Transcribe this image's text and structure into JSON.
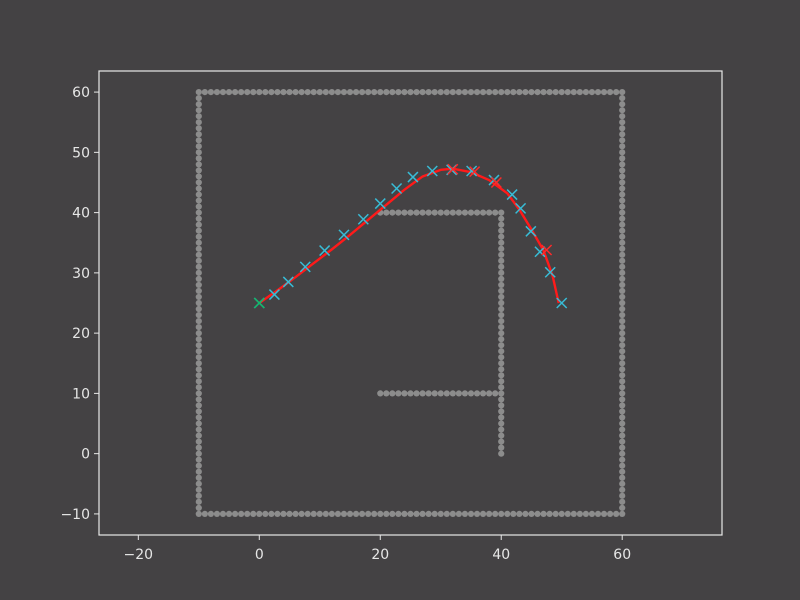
{
  "chart_data": {
    "type": "scatter",
    "title": "",
    "xlabel": "",
    "ylabel": "",
    "xlim": [
      -26.5,
      76.5
    ],
    "ylim": [
      -13.5,
      63.5
    ],
    "x_ticks": [
      -20,
      0,
      20,
      40,
      60
    ],
    "y_ticks": [
      -10,
      0,
      10,
      20,
      30,
      40,
      50,
      60
    ],
    "x_tick_labels": [
      "−20",
      "0",
      "20",
      "40",
      "60"
    ],
    "y_tick_labels": [
      "−10",
      "0",
      "10",
      "20",
      "30",
      "40",
      "50",
      "60"
    ],
    "grid": false,
    "legend": "none",
    "colors": {
      "background": "#444244",
      "axes_frame": "#e8e8e8",
      "obstacles": "#8c8c8c",
      "path": "#ff1a1a",
      "path_nodes": "#ff2a2a",
      "waypoints": "#38bcd6",
      "start": "#12b86a"
    },
    "obstacles": {
      "marker": "circle",
      "spacing": 1,
      "segments": [
        {
          "x": [
            -10,
            60
          ],
          "y": [
            60,
            60
          ]
        },
        {
          "x": [
            -10,
            60
          ],
          "y": [
            -10,
            -10
          ]
        },
        {
          "x": [
            -10,
            -10
          ],
          "y": [
            -10,
            60
          ]
        },
        {
          "x": [
            60,
            60
          ],
          "y": [
            -10,
            60
          ]
        },
        {
          "x": [
            20,
            40
          ],
          "y": [
            40,
            40
          ]
        },
        {
          "x": [
            40,
            40
          ],
          "y": [
            0,
            40
          ]
        },
        {
          "x": [
            20,
            40
          ],
          "y": [
            10,
            10
          ]
        }
      ]
    },
    "series": [
      {
        "marker": "x",
        "color": "#38bcd6",
        "x": [
          0,
          2.5,
          4.8,
          7.6,
          10.8,
          14,
          17.2,
          20,
          22.7,
          25.4,
          28.6,
          31.8,
          35.1,
          38.8,
          41.8,
          43.2,
          44.9,
          46.4,
          48.1,
          50
        ],
        "y": [
          25,
          26.4,
          28.5,
          31,
          33.7,
          36.3,
          38.9,
          41.5,
          44,
          45.9,
          46.9,
          47.1,
          46.9,
          45.4,
          43,
          40.7,
          36.9,
          33.5,
          30.1,
          25
        ]
      },
      {
        "marker": "x",
        "color": "#ff2a2a",
        "x": [
          32,
          35.6,
          39.2,
          47.5
        ],
        "y": [
          47.2,
          46.8,
          45,
          33.8
        ]
      },
      {
        "marker": "line",
        "color": "#ff1a1a",
        "x": [
          0,
          3,
          6,
          9,
          12,
          15,
          18,
          21,
          24,
          27,
          30,
          32,
          35,
          38,
          41,
          43,
          45,
          47,
          48.5,
          49.5
        ],
        "y": [
          25,
          27.1,
          29.3,
          31.6,
          33.9,
          36.3,
          38.8,
          41.3,
          43.8,
          46,
          47.1,
          47.3,
          46.7,
          45.4,
          43.2,
          40.5,
          37.2,
          33.7,
          29.5,
          25
        ]
      },
      {
        "marker": "x",
        "color": "#12b86a",
        "x": [
          0
        ],
        "y": [
          25
        ]
      }
    ]
  }
}
